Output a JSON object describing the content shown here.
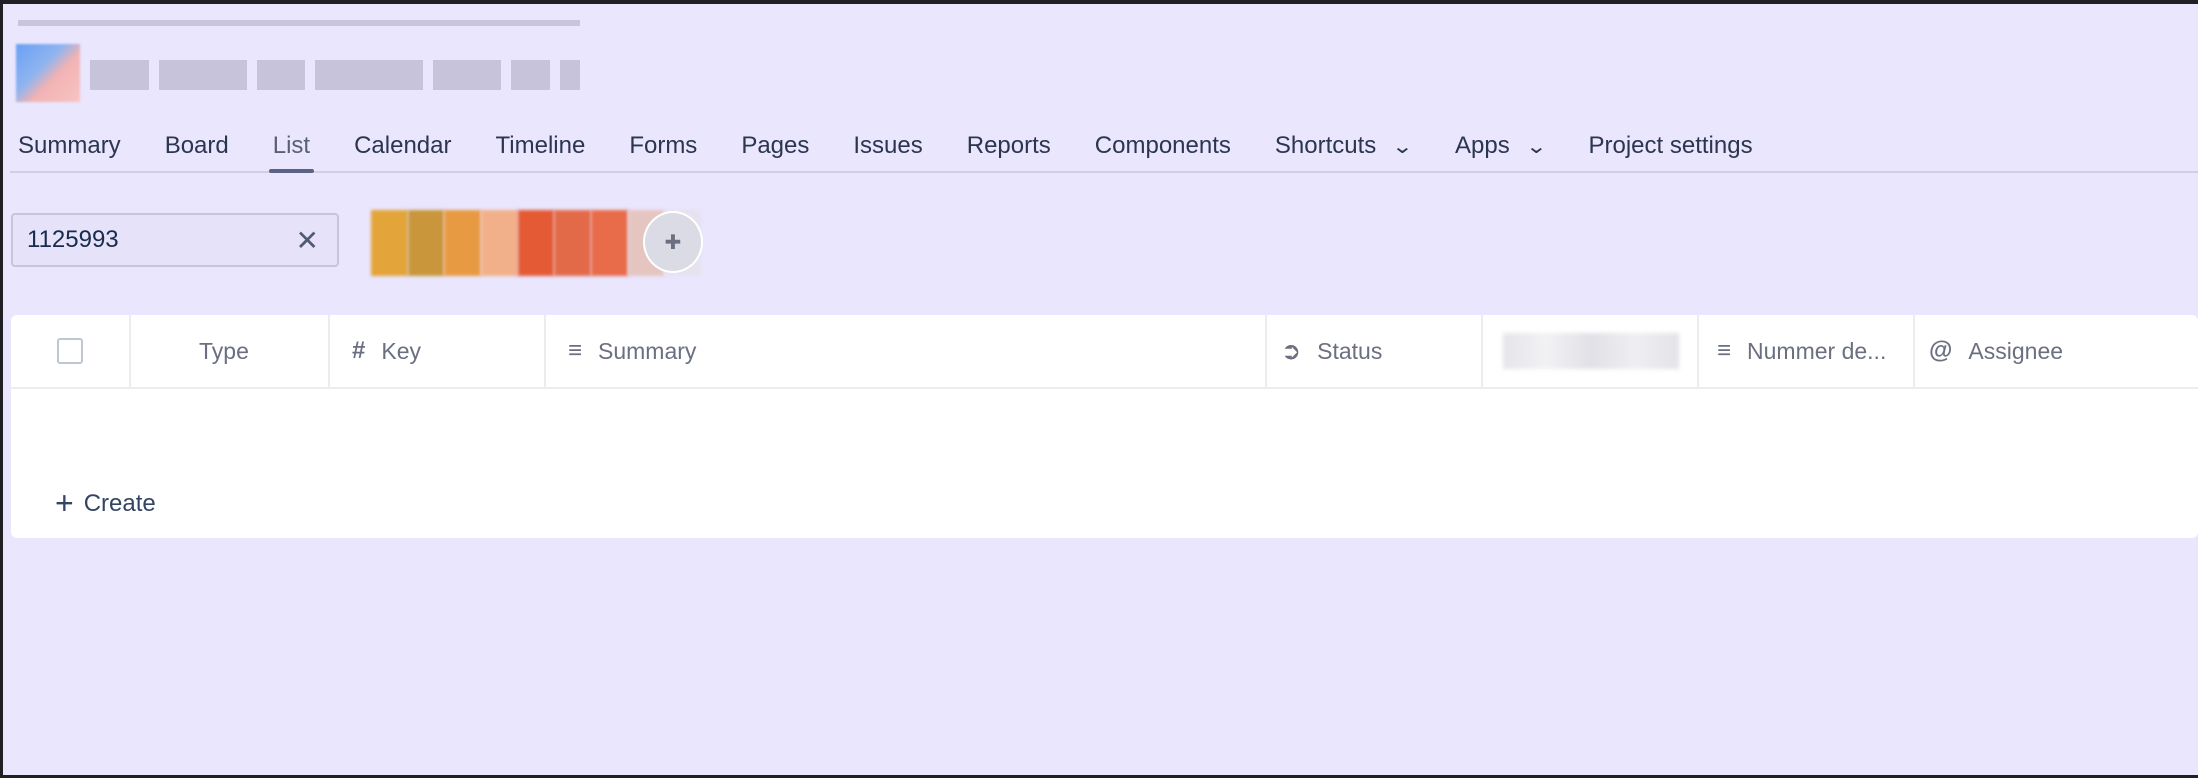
{
  "nav": {
    "tabs": [
      {
        "label": "Summary"
      },
      {
        "label": "Board"
      },
      {
        "label": "List",
        "active": true
      },
      {
        "label": "Calendar"
      },
      {
        "label": "Timeline"
      },
      {
        "label": "Forms"
      },
      {
        "label": "Pages"
      },
      {
        "label": "Issues"
      },
      {
        "label": "Reports"
      },
      {
        "label": "Components"
      },
      {
        "label": "Shortcuts",
        "dropdown": true
      },
      {
        "label": "Apps",
        "dropdown": true
      },
      {
        "label": "Project settings"
      }
    ]
  },
  "search": {
    "value": "1125993",
    "clear_icon": "close-icon"
  },
  "table": {
    "columns": [
      {
        "label": "",
        "icon": "checkbox"
      },
      {
        "label": "Type",
        "icon": ""
      },
      {
        "label": "Key",
        "icon": "hash-icon"
      },
      {
        "label": "Summary",
        "icon": "text-lines-icon"
      },
      {
        "label": "Status",
        "icon": "arrow-circle-icon"
      },
      {
        "label": "",
        "icon": "blurred"
      },
      {
        "label": "Nummer de...",
        "icon": "text-lines-icon"
      },
      {
        "label": "Assignee",
        "icon": "at-icon"
      }
    ],
    "create_label": "Create"
  }
}
